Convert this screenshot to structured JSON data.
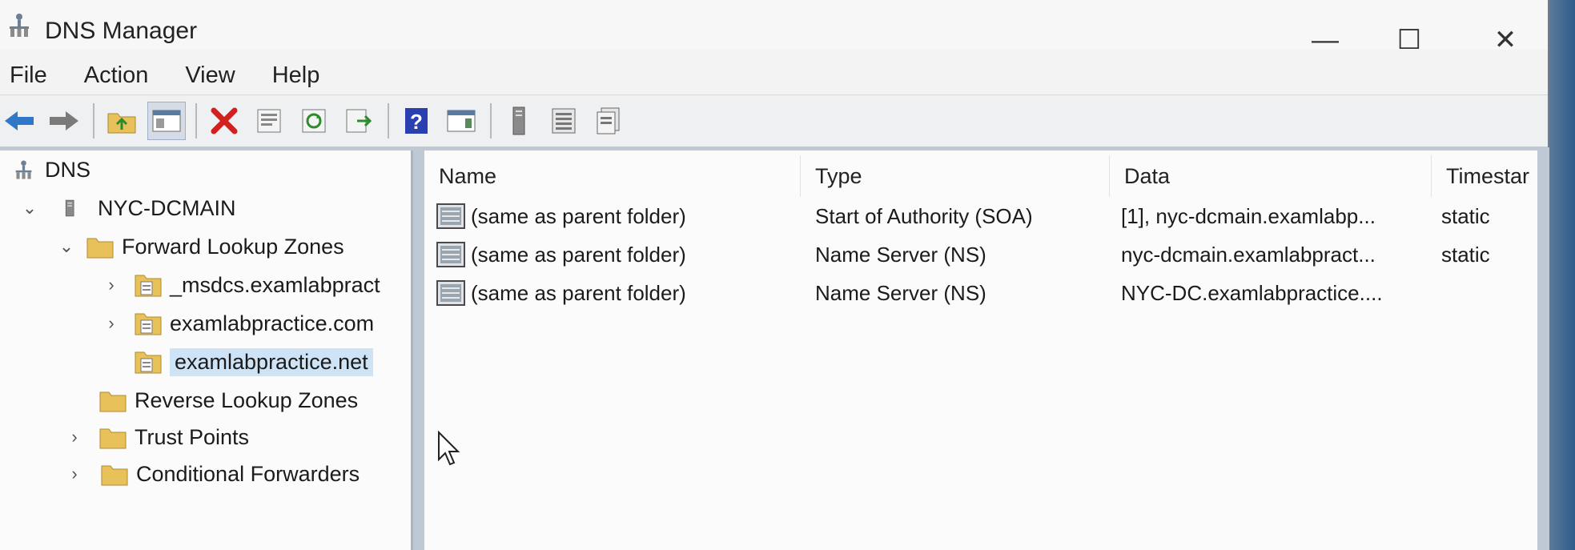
{
  "window": {
    "title": "DNS Manager"
  },
  "title_controls": {
    "minimize": "—",
    "maximize": "☐",
    "close": "✕"
  },
  "menu": [
    "File",
    "Action",
    "View",
    "Help"
  ],
  "toolbar": {
    "buttons": [
      "back-icon",
      "forward-icon",
      "up-folder-icon",
      "show-hide-tree-icon",
      "delete-icon",
      "properties-icon",
      "refresh-icon",
      "export-list-icon",
      "help-icon",
      "show-hide-action-pane-icon",
      "new-host-icon",
      "new-zone-icon",
      "new-record-icon"
    ]
  },
  "tree": {
    "root": "DNS",
    "server": "NYC-DCMAIN",
    "forward_zones": "Forward Lookup Zones",
    "zones": [
      "_msdcs.examlabpract",
      "examlabpractice.com",
      "examlabpractice.net"
    ],
    "reverse_zones": "Reverse Lookup Zones",
    "trust_points": "Trust Points",
    "conditional_forwarders": "Conditional Forwarders"
  },
  "list": {
    "columns": [
      "Name",
      "Type",
      "Data",
      "Timestar"
    ],
    "rows": [
      {
        "name": "(same as parent folder)",
        "type": "Start of Authority (SOA)",
        "data": "[1], nyc-dcmain.examlabp...",
        "timestamp": "static"
      },
      {
        "name": "(same as parent folder)",
        "type": "Name Server (NS)",
        "data": "nyc-dcmain.examlabpract...",
        "timestamp": "static"
      },
      {
        "name": "(same as parent folder)",
        "type": "Name Server (NS)",
        "data": "NYC-DC.examlabpractice....",
        "timestamp": ""
      }
    ]
  },
  "colors": {
    "selection": "#cfe3f7",
    "folder": "#e8c15a",
    "accent_blue": "#2c5c8c"
  }
}
